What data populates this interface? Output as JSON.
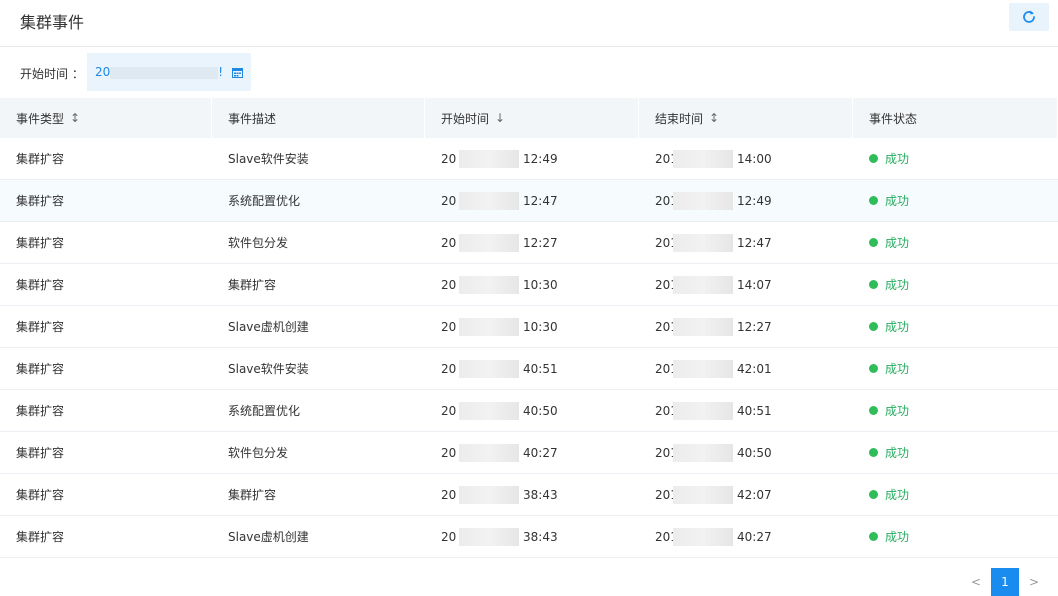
{
  "header": {
    "title": "集群事件"
  },
  "filter": {
    "label": "开始时间 ：",
    "date_prefix": "20",
    "date_suffix": "!"
  },
  "table": {
    "columns": [
      "事件类型",
      "事件描述",
      "开始时间",
      "结束时间",
      "事件状态"
    ],
    "sort_icons": [
      "↕",
      "",
      "↓",
      "↕",
      ""
    ],
    "rows": [
      {
        "type": "集群扩容",
        "desc": "Slave软件安装",
        "start_prefix": "20",
        "start": "12:49",
        "end_prefix": "201",
        "end": "14:00",
        "status": "成功"
      },
      {
        "type": "集群扩容",
        "desc": "系统配置优化",
        "start_prefix": "20",
        "start": "12:47",
        "end_prefix": "201",
        "end": "12:49",
        "status": "成功"
      },
      {
        "type": "集群扩容",
        "desc": "软件包分发",
        "start_prefix": "20",
        "start": "12:27",
        "end_prefix": "201",
        "end": "12:47",
        "status": "成功"
      },
      {
        "type": "集群扩容",
        "desc": "集群扩容",
        "start_prefix": "20",
        "start": "10:30",
        "end_prefix": "201",
        "end": "14:07",
        "status": "成功"
      },
      {
        "type": "集群扩容",
        "desc": "Slave虚机创建",
        "start_prefix": "20",
        "start": "10:30",
        "end_prefix": "201",
        "end": "12:27",
        "status": "成功"
      },
      {
        "type": "集群扩容",
        "desc": "Slave软件安装",
        "start_prefix": "20",
        "start": "40:51",
        "end_prefix": "201",
        "end": "42:01",
        "status": "成功"
      },
      {
        "type": "集群扩容",
        "desc": "系统配置优化",
        "start_prefix": "20",
        "start": "40:50",
        "end_prefix": "201",
        "end": "40:51",
        "status": "成功"
      },
      {
        "type": "集群扩容",
        "desc": "软件包分发",
        "start_prefix": "20",
        "start": "40:27",
        "end_prefix": "201",
        "end": "40:50",
        "status": "成功"
      },
      {
        "type": "集群扩容",
        "desc": "集群扩容",
        "start_prefix": "20",
        "start": "38:43",
        "end_prefix": "201",
        "end": "42:07",
        "status": "成功"
      },
      {
        "type": "集群扩容",
        "desc": "Slave虚机创建",
        "start_prefix": "20",
        "start": "38:43",
        "end_prefix": "201",
        "end": "40:27",
        "status": "成功"
      }
    ]
  },
  "pager": {
    "prev": "<",
    "current": "1",
    "next": ">"
  },
  "colors": {
    "accent": "#1a8cf0",
    "success": "#2ebd59"
  },
  "icons": {
    "refresh": "refresh-icon",
    "calendar": "calendar-icon"
  }
}
